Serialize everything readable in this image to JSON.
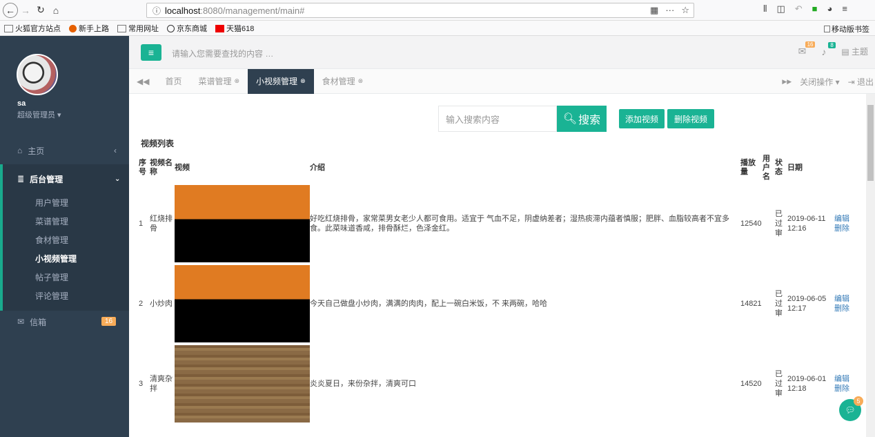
{
  "browser": {
    "url_host": "localhost",
    "url_path": ":8080/management/main#",
    "bookmarks": [
      {
        "label": "火狐官方站点"
      },
      {
        "label": "新手上路"
      },
      {
        "label": "常用网址"
      },
      {
        "label": "京东商城"
      },
      {
        "label": "天猫618"
      }
    ],
    "mobile_bookmarks": "移动版书签"
  },
  "sidebar": {
    "username": "sa",
    "role": "超级管理员",
    "home": "主页",
    "admin": "后台管理",
    "sub_items": [
      {
        "label": "用户管理"
      },
      {
        "label": "菜谱管理"
      },
      {
        "label": "食材管理"
      },
      {
        "label": "小视频管理"
      },
      {
        "label": "帖子管理"
      },
      {
        "label": "评论管理"
      }
    ],
    "mail": "信箱",
    "mail_count": "16"
  },
  "topbar": {
    "search_placeholder": "请输入您需要查找的内容 …",
    "msg_count": "16",
    "bell_count": "8",
    "theme": "主题"
  },
  "tabs": {
    "items": [
      {
        "label": "首页"
      },
      {
        "label": "菜谱管理"
      },
      {
        "label": "小视频管理"
      },
      {
        "label": "食材管理"
      }
    ],
    "close_ops": "关闭操作",
    "logout": "退出"
  },
  "main": {
    "search_placeholder": "输入搜索内容",
    "search_btn": "搜索",
    "add_btn": "添加视频",
    "del_btn": "删除视频",
    "list_title": "视频列表",
    "headers": {
      "no": "序号",
      "name": "视频名称",
      "video": "视频",
      "intro": "介绍",
      "plays": "播放量",
      "user": "用户名",
      "status": "状态",
      "date": "日期"
    },
    "rows": [
      {
        "no": "1",
        "name": "红烧排骨",
        "intro": "好吃红烧排骨，家常菜男女老少人都可食用。适宜于 气血不足，阴虚纳差者；湿热痰滞内蕴者慎服；肥胖、血脂较高者不宜多食。此菜味道香咸，排骨酥烂，色泽金红。",
        "plays": "12540",
        "status": "已过审",
        "date": "2019-06-11 12:16",
        "edit": "编辑",
        "delete": "删除"
      },
      {
        "no": "2",
        "name": "小炒肉",
        "intro": "今天自己做盘小炒肉，满满的肉肉，配上一碗白米饭，不 来两碗，哈哈",
        "plays": "14821",
        "status": "已过审",
        "date": "2019-06-05 12:17",
        "edit": "编辑",
        "delete": "删除"
      },
      {
        "no": "3",
        "name": "清爽杂拌",
        "intro": "炎炎夏日，来份杂拌，清爽可口",
        "plays": "14520",
        "status": "已过审",
        "date": "2019-06-01 12:18",
        "edit": "编辑",
        "delete": "删除"
      }
    ]
  },
  "chat_badge": "5"
}
